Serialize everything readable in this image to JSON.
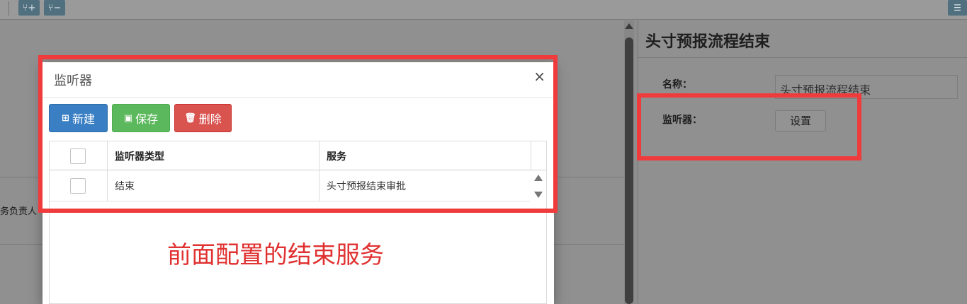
{
  "background": {
    "left_cut_text": "务负责人",
    "right_panel": {
      "title": "头寸预报流程结束",
      "name_label": "名称：",
      "name_value": "头寸预报流程结束",
      "listener_label": "监听器：",
      "settings_button": "设置"
    }
  },
  "modal": {
    "title": "监听器",
    "close": "×",
    "toolbar": {
      "new_label": "新建",
      "save_label": "保存",
      "delete_label": "删除"
    },
    "table": {
      "headers": [
        "监听器类型",
        "服务"
      ],
      "rows": [
        {
          "type": "结束",
          "service": "头寸预报结束审批"
        }
      ]
    }
  },
  "annotation": {
    "text": "前面配置的结束服务",
    "color": "#e03030",
    "box_color": "#ef3b3b"
  },
  "colors": {
    "primary": "#3a7fc3",
    "success": "#5cb85c",
    "danger": "#d9534f"
  }
}
